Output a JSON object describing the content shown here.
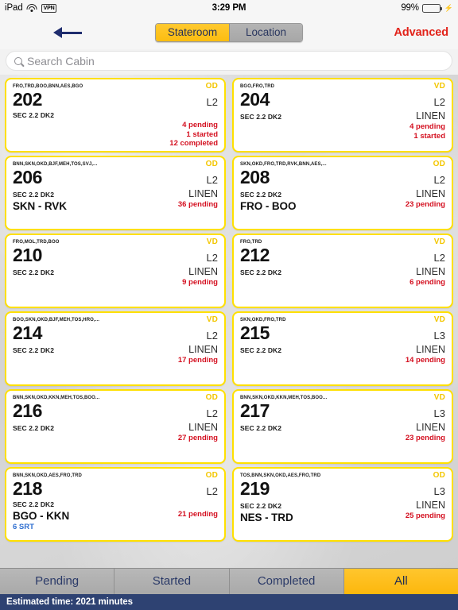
{
  "status_bar": {
    "device": "iPad",
    "wifi_icon": "wifi-icon",
    "vpn_label": "VPN",
    "time": "3:29 PM",
    "battery_percent": "99%",
    "battery_icon": "battery-icon",
    "charging_icon": "lightning-bolt-icon"
  },
  "nav": {
    "menu_icon": "hamburger-menu-icon",
    "back_icon": "back-arrow-icon",
    "segments": [
      {
        "label": "Stateroom",
        "active": true
      },
      {
        "label": "Location",
        "active": false
      }
    ],
    "advanced_label": "Advanced",
    "advanced_color": "#e2231a"
  },
  "search": {
    "icon": "search-icon",
    "placeholder": "Search Cabin",
    "value": ""
  },
  "colors": {
    "card_border": "#ffe000",
    "badge": "#f3c600",
    "status_red": "#d41020",
    "srt_blue": "#2f6fd0",
    "tab_active": "#fcb70c",
    "footer_bg": "#2e4272"
  },
  "cards": [
    {
      "ports": "FRO,TRD,BOO,BNN,AES,BGO",
      "badge": "OD",
      "cabin": "202",
      "deck": "L2",
      "section": "SEC 2.2 DK2",
      "linen": "",
      "route": "",
      "statuses": [
        "4 pending",
        "1 started",
        "12 completed"
      ],
      "srt": ""
    },
    {
      "ports": "BGO,FRO,TRD",
      "badge": "VD",
      "cabin": "204",
      "deck": "L2",
      "section": "SEC 2.2 DK2",
      "linen": "LINEN",
      "route": "",
      "statuses": [
        "4 pending",
        "1 started"
      ],
      "srt": ""
    },
    {
      "ports": "BNN,SKN,OKD,BJF,MEH,TOS,SVJ,...",
      "badge": "OD",
      "cabin": "206",
      "deck": "L2",
      "section": "SEC 2.2 DK2",
      "linen": "LINEN",
      "route": "SKN - RVK",
      "statuses": [
        "36 pending"
      ],
      "srt": ""
    },
    {
      "ports": "SKN,OKD,FRO,TRD,RVK,BNN,AES,...",
      "badge": "OD",
      "cabin": "208",
      "deck": "L2",
      "section": "SEC 2.2 DK2",
      "linen": "LINEN",
      "route": "FRO - BOO",
      "statuses": [
        "23 pending"
      ],
      "srt": ""
    },
    {
      "ports": "FRO,MOL,TRD,BOO",
      "badge": "VD",
      "cabin": "210",
      "deck": "L2",
      "section": "SEC 2.2 DK2",
      "linen": "LINEN",
      "route": "",
      "statuses": [
        "9 pending"
      ],
      "srt": ""
    },
    {
      "ports": "FRO,TRD",
      "badge": "VD",
      "cabin": "212",
      "deck": "L2",
      "section": "SEC 2.2 DK2",
      "linen": "LINEN",
      "route": "",
      "statuses": [
        "6 pending"
      ],
      "srt": ""
    },
    {
      "ports": "BOO,SKN,OKD,BJF,MEH,TOS,HRO,...",
      "badge": "VD",
      "cabin": "214",
      "deck": "L2",
      "section": "SEC 2.2 DK2",
      "linen": "LINEN",
      "route": "",
      "statuses": [
        "17 pending"
      ],
      "srt": ""
    },
    {
      "ports": "SKN,OKD,FRO,TRD",
      "badge": "VD",
      "cabin": "215",
      "deck": "L3",
      "section": "SEC 2.2 DK2",
      "linen": "LINEN",
      "route": "",
      "statuses": [
        "14 pending"
      ],
      "srt": ""
    },
    {
      "ports": "BNN,SKN,OKD,KKN,MEH,TOS,BOO...",
      "badge": "OD",
      "cabin": "216",
      "deck": "L2",
      "section": "SEC 2.2 DK2",
      "linen": "LINEN",
      "route": "",
      "statuses": [
        "27 pending"
      ],
      "srt": ""
    },
    {
      "ports": "BNN,SKN,OKD,KKN,MEH,TOS,BOO...",
      "badge": "VD",
      "cabin": "217",
      "deck": "L3",
      "section": "SEC 2.2 DK2",
      "linen": "LINEN",
      "route": "",
      "statuses": [
        "23 pending"
      ],
      "srt": ""
    },
    {
      "ports": "BNN,SKN,OKD,AES,FRO,TRD",
      "badge": "OD",
      "cabin": "218",
      "deck": "L2",
      "section": "SEC 2.2 DK2",
      "linen": "",
      "route": "BGO - KKN",
      "statuses": [
        "21 pending"
      ],
      "srt": "6 SRT"
    },
    {
      "ports": "TOS,BNN,SKN,OKD,AES,FRO,TRD",
      "badge": "OD",
      "cabin": "219",
      "deck": "L3",
      "section": "SEC 2.2 DK2",
      "linen": "LINEN",
      "route": "NES - TRD",
      "statuses": [
        "25 pending"
      ],
      "srt": ""
    }
  ],
  "tabs": [
    {
      "label": "Pending",
      "active": false
    },
    {
      "label": "Started",
      "active": false
    },
    {
      "label": "Completed",
      "active": false
    },
    {
      "label": "All",
      "active": true
    }
  ],
  "footer": {
    "estimated_time": "Estimated time: 2021 minutes"
  }
}
